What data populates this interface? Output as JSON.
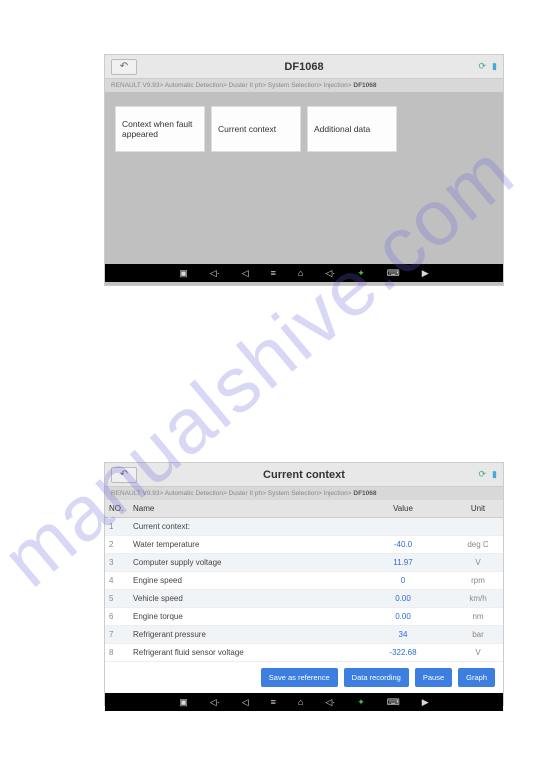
{
  "watermark": "manualshive.com",
  "screen1": {
    "title": "DF1068",
    "breadcrumb_prefix": "RENAULT V9.93> Automatic Detection> Duster II ph> System Selection> Injection> ",
    "breadcrumb_last": "DF1068",
    "cards": [
      {
        "label": "Context when fault appeared"
      },
      {
        "label": "Current context"
      },
      {
        "label": "Additional data"
      }
    ]
  },
  "screen2": {
    "title": "Current context",
    "breadcrumb_prefix": "RENAULT V9.93> Automatic Detection> Duster II ph> System Selection> Injection> ",
    "breadcrumb_last": "DF1068",
    "headers": {
      "no": "NO.",
      "name": "Name",
      "value": "Value",
      "unit": "Unit"
    },
    "rows": [
      {
        "no": "1",
        "name": "Current context:",
        "value": "",
        "unit": ""
      },
      {
        "no": "2",
        "name": "Water temperature",
        "value": "-40.0",
        "unit": "deg C"
      },
      {
        "no": "3",
        "name": "Computer supply voltage",
        "value": "11.97",
        "unit": "V"
      },
      {
        "no": "4",
        "name": "Engine speed",
        "value": "0",
        "unit": "rpm"
      },
      {
        "no": "5",
        "name": "Vehicle speed",
        "value": "0.00",
        "unit": "km/h"
      },
      {
        "no": "6",
        "name": "Engine torque",
        "value": "0.00",
        "unit": "nm"
      },
      {
        "no": "7",
        "name": "Refrigerant pressure",
        "value": "34",
        "unit": "bar"
      },
      {
        "no": "8",
        "name": "Refrigerant fluid sensor voltage",
        "value": "-322.68",
        "unit": "V"
      }
    ],
    "buttons": {
      "save": "Save as reference",
      "record": "Data recording",
      "pause": "Pause",
      "graph": "Graph"
    }
  },
  "nav": {
    "gallery": "▣",
    "prev": "◁·",
    "back": "◁",
    "menu": "≡",
    "home": "⌂",
    "next": "◁·",
    "star": "✦",
    "chat": "⌨",
    "video": "▶"
  },
  "icons": {
    "refresh": "⟳",
    "battery": "▮"
  }
}
